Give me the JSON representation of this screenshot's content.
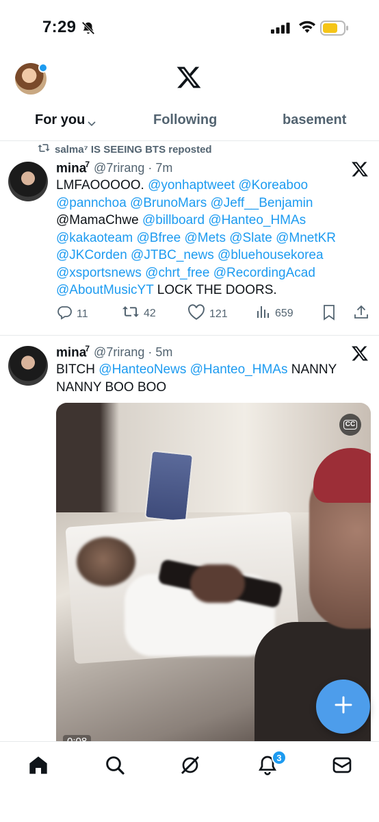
{
  "status_bar": {
    "time": "7:29",
    "battery_color": "#f5c518"
  },
  "header": {
    "logo": "X"
  },
  "tabs": [
    {
      "label": "For you",
      "active": true
    },
    {
      "label": "Following",
      "active": false
    },
    {
      "label": "basement",
      "active": false
    }
  ],
  "tweets": [
    {
      "repost_label": "salma⁷ IS SEEING BTS reposted",
      "name": "mina",
      "name_sup": "7",
      "handle_time": "@7rirang · 7m",
      "body_lines": [
        [
          {
            "t": "LMFAOOOOO. ",
            "m": false
          },
          {
            "t": " @yonhaptweet @Koreaboo",
            "m": true
          }
        ],
        [
          {
            "t": "@pannchoa @BrunoMars @Jeff__Benjamin",
            "m": true
          }
        ],
        [
          {
            "t": "@MamaChwe ",
            "m": false
          },
          {
            "t": "@billboard @Hanteo_HMAs",
            "m": true
          }
        ],
        [
          {
            "t": "@kakaoteam @Bfree @Mets @Slate @MnetKR",
            "m": true
          }
        ],
        [
          {
            "t": "@JKCorden @JTBC_news @bluehousekorea",
            "m": true
          }
        ],
        [
          {
            "t": "@xsportsnews @chrt_free @RecordingAcad",
            "m": true
          }
        ],
        [
          {
            "t": "@AboutMusicYT",
            "m": true
          },
          {
            "t": " LOCK THE DOORS.",
            "m": false
          }
        ]
      ],
      "replies": "11",
      "reposts": "42",
      "likes": "121",
      "views": "659"
    },
    {
      "name": "mina",
      "name_sup": "7",
      "handle_time": "@7rirang · 5m",
      "body_lines": [
        [
          {
            "t": "BITCH ",
            "m": false
          },
          {
            "t": "@HanteoNews @Hanteo_HMAs",
            "m": true
          },
          {
            "t": " NANNY",
            "m": false
          }
        ],
        [
          {
            "t": "NANNY BOO BOO",
            "m": false
          }
        ]
      ],
      "video_time": "0:08",
      "cc_label": "CC"
    }
  ],
  "bottom_nav": {
    "items": [
      "home-icon",
      "search-icon",
      "grok-icon",
      "bell-icon",
      "mail-icon"
    ],
    "notification_count": "3"
  },
  "colors": {
    "accent": "#1d9bf0",
    "fab": "#4d9deb"
  }
}
